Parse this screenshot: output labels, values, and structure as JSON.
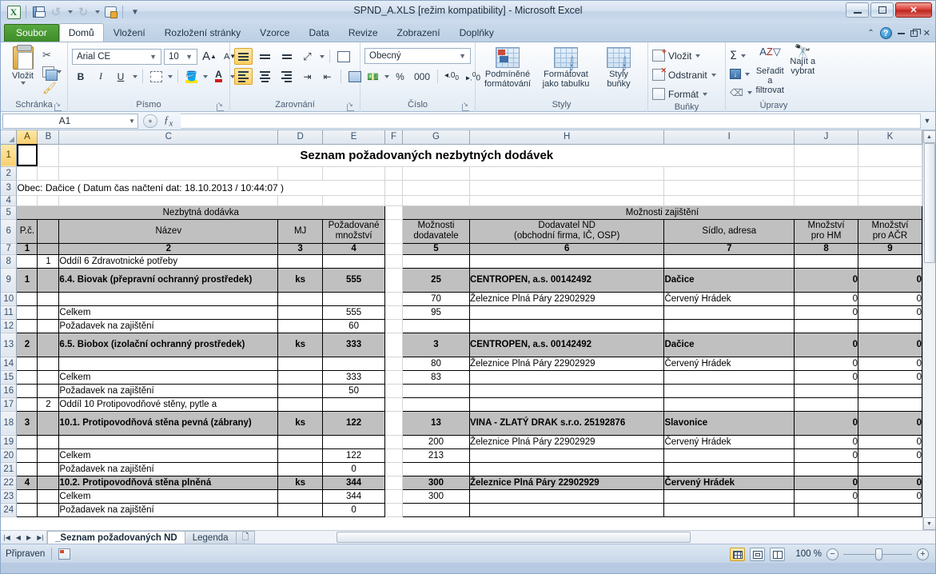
{
  "window": {
    "title": "SPND_A.XLS  [režim kompatibility]  -  Microsoft Excel",
    "qat": {
      "excel_logo": "X",
      "save_tooltip": "Uložit",
      "undo_tooltip": "Zpět",
      "redo_tooltip": "Znovu",
      "print_tooltip": "Náhled a tisk",
      "more_tooltip": "Přizpůsobit panel nástrojů Rychlý přístup"
    },
    "controls": {
      "minimize": "—",
      "maximize": "□",
      "close": "✕"
    }
  },
  "ribbon": {
    "tabs": [
      {
        "label": "Soubor",
        "kind": "file"
      },
      {
        "label": "Domů",
        "kind": "active"
      },
      {
        "label": "Vložení",
        "kind": "normal"
      },
      {
        "label": "Rozložení stránky",
        "kind": "normal"
      },
      {
        "label": "Vzorce",
        "kind": "normal"
      },
      {
        "label": "Data",
        "kind": "normal"
      },
      {
        "label": "Revize",
        "kind": "normal"
      },
      {
        "label": "Zobrazení",
        "kind": "normal"
      },
      {
        "label": "Doplňky",
        "kind": "normal"
      }
    ],
    "help_label": "?",
    "groups": {
      "clipboard": {
        "label": "Schránka",
        "paste": "Vložit",
        "cut": "Vyjmout",
        "copy": "Kopírovat",
        "format_painter": "Kopírovat formát"
      },
      "font": {
        "label": "Písmo",
        "font_name": "Arial CE",
        "font_size": "10",
        "grow": "A",
        "shrink": "A",
        "bold": "B",
        "italic": "I",
        "underline": "U",
        "borders": "Ohraničení",
        "fill_color": "Barva výplně",
        "font_color": "A"
      },
      "alignment": {
        "label": "Zarovnání",
        "align_top": "Zarovnat nahoru",
        "align_middle": "Zarovnat na střed svisle",
        "align_bottom": "Zarovnat dolů",
        "orientation": "Orientace",
        "align_left": "Zarovnat vlevo",
        "align_center": "Zarovnat na střed",
        "align_right": "Zarovnat vpravo",
        "decrease_indent": "Zmenšit odsazení",
        "increase_indent": "Zvětšit odsazení",
        "wrap_text": "Zalamovat text",
        "merge_center": "Sloučit a zarovnat na střed"
      },
      "number": {
        "label": "Číslo",
        "format": "Obecný",
        "accounting": "Formát účetnického čísla",
        "percent": "%",
        "comma": "000",
        "increase_decimal": "Přidat desetinné místo",
        "decrease_decimal": "Odebrat desetinné místo"
      },
      "styles": {
        "label": "Styly",
        "conditional": "Podmíněné formátování",
        "as_table": "Formátovat jako tabulku",
        "cell_styles": "Styly buňky"
      },
      "cells": {
        "label": "Buňky",
        "insert": "Vložit",
        "delete": "Odstranit",
        "format": "Formát"
      },
      "editing": {
        "label": "Úpravy",
        "autosum": "Σ",
        "fill": "Výplň",
        "clear": "Vymazat",
        "sort_filter": "Seřadit a filtrovat",
        "find_select": "Najít a vybrat"
      }
    }
  },
  "formula_bar": {
    "name_box": "A1",
    "formula": ""
  },
  "grid": {
    "column_headers": [
      "A",
      "B",
      "C",
      "D",
      "E",
      "F",
      "G",
      "H",
      "I",
      "J",
      "K"
    ],
    "selected_column": "A",
    "selected_row": "1",
    "row_numbers": [
      "1",
      "2",
      "3",
      "4",
      "5",
      "6",
      "7",
      "8",
      "9",
      "10",
      "11",
      "12",
      "13",
      "14",
      "15",
      "16",
      "17",
      "18",
      "19",
      "20",
      "21",
      "22",
      "23",
      "24"
    ],
    "doc_title": "Seznam požadovaných nezbytných dodávek",
    "info_line": "Obec: Dačice            ( Datum čas načtení dat: 18.10.2013 / 10:44:07 )",
    "group_headers": {
      "left": "Nezbytná dodávka",
      "right": "Možnosti zajištění"
    },
    "column_titles": {
      "pc": "P.č.",
      "nazev": "Název",
      "mj": "MJ",
      "pozadovane_mnozstvi": "Požadované množství",
      "moznosti_dodavatele": "Možnosti dodavatele",
      "dodavatel_nd": "Dodavatel ND (obchodní firma, IČ, OSP)",
      "dodavatel_nd_l1": "Dodavatel ND",
      "dodavatel_nd_l2": "(obchodní firma, IČ, OSP)",
      "sidlo": "Sídlo, adresa",
      "mnozstvi_hm_l1": "Množství",
      "mnozstvi_hm_l2": "pro HM",
      "mnozstvi_acr_l1": "Množství",
      "mnozstvi_acr_l2": "pro AČR"
    },
    "column_numbers": [
      "1",
      "2",
      "3",
      "4",
      "5",
      "6",
      "7",
      "8",
      "9"
    ],
    "rows": [
      {
        "row": "8",
        "style": "plain",
        "pc": "",
        "sub": "1",
        "nazev": "Oddíl 6 Zdravotnické potřeby",
        "mj": "",
        "qty": "",
        "supcount": "",
        "supplier": "",
        "address": "",
        "hm": "",
        "acr": ""
      },
      {
        "row": "9",
        "style": "shaded-bold",
        "tall": true,
        "pc": "1",
        "sub": "",
        "nazev": "6.4. Biovak (přepravní ochranný prostředek)",
        "mj": "ks",
        "qty": "555",
        "supcount": "25",
        "supplier": "CENTROPEN,  a.s. 00142492",
        "address": "Dačice",
        "hm": "0",
        "acr": "0"
      },
      {
        "row": "10",
        "style": "plain",
        "pc": "",
        "sub": "",
        "nazev": "",
        "mj": "",
        "qty": "",
        "supcount": "70",
        "supplier": "Železnice Plná Páry 22902929",
        "address": "Červený Hrádek",
        "hm": "0",
        "acr": "0"
      },
      {
        "row": "11",
        "style": "plain",
        "pc": "",
        "sub": "",
        "nazev": "Celkem",
        "mj": "",
        "qty": "555",
        "supcount": "95",
        "supplier": "",
        "address": "",
        "hm": "0",
        "acr": "0"
      },
      {
        "row": "12",
        "style": "plain",
        "pc": "",
        "sub": "",
        "nazev": "Požadavek na zajištění",
        "mj": "",
        "qty": "60",
        "supcount": "",
        "supplier": "",
        "address": "",
        "hm": "",
        "acr": ""
      },
      {
        "row": "13",
        "style": "shaded-bold",
        "tall": true,
        "pc": "2",
        "sub": "",
        "nazev": "6.5. Biobox (izolační ochranný prostředek)",
        "mj": "ks",
        "qty": "333",
        "supcount": "3",
        "supplier": "CENTROPEN,  a.s. 00142492",
        "address": "Dačice",
        "hm": "0",
        "acr": "0"
      },
      {
        "row": "14",
        "style": "plain",
        "pc": "",
        "sub": "",
        "nazev": "",
        "mj": "",
        "qty": "",
        "supcount": "80",
        "supplier": "Železnice Plná Páry 22902929",
        "address": "Červený Hrádek",
        "hm": "0",
        "acr": "0"
      },
      {
        "row": "15",
        "style": "plain",
        "pc": "",
        "sub": "",
        "nazev": "Celkem",
        "mj": "",
        "qty": "333",
        "supcount": "83",
        "supplier": "",
        "address": "",
        "hm": "0",
        "acr": "0"
      },
      {
        "row": "16",
        "style": "plain",
        "pc": "",
        "sub": "",
        "nazev": "Požadavek na zajištění",
        "mj": "",
        "qty": "50",
        "supcount": "",
        "supplier": "",
        "address": "",
        "hm": "",
        "acr": ""
      },
      {
        "row": "17",
        "style": "plain",
        "pc": "",
        "sub": "2",
        "nazev": "Oddíl 10 Protipovodňové stěny, pytle a",
        "mj": "",
        "qty": "",
        "supcount": "",
        "supplier": "",
        "address": "",
        "hm": "",
        "acr": ""
      },
      {
        "row": "18",
        "style": "shaded-bold",
        "tall": true,
        "pc": "3",
        "sub": "",
        "nazev": "10.1. Protipovodňová stěna pevná (zábrany)",
        "mj": "ks",
        "qty": "122",
        "supcount": "13",
        "supplier": "VINA - ZLATÝ DRAK s.r.o. 25192876",
        "address": "Slavonice",
        "hm": "0",
        "acr": "0"
      },
      {
        "row": "19",
        "style": "plain",
        "pc": "",
        "sub": "",
        "nazev": "",
        "mj": "",
        "qty": "",
        "supcount": "200",
        "supplier": "Železnice Plná Páry 22902929",
        "address": "Červený Hrádek",
        "hm": "0",
        "acr": "0"
      },
      {
        "row": "20",
        "style": "plain",
        "pc": "",
        "sub": "",
        "nazev": "Celkem",
        "mj": "",
        "qty": "122",
        "supcount": "213",
        "supplier": "",
        "address": "",
        "hm": "0",
        "acr": "0"
      },
      {
        "row": "21",
        "style": "plain",
        "pc": "",
        "sub": "",
        "nazev": "Požadavek na zajištění",
        "mj": "",
        "qty": "0",
        "supcount": "",
        "supplier": "",
        "address": "",
        "hm": "",
        "acr": ""
      },
      {
        "row": "22",
        "style": "shaded-bold",
        "pc": "4",
        "sub": "",
        "nazev": "10.2. Protipovodňová stěna plněná",
        "mj": "ks",
        "qty": "344",
        "supcount": "300",
        "supplier": "Železnice Plná Páry 22902929",
        "address": "Červený Hrádek",
        "hm": "0",
        "acr": "0"
      },
      {
        "row": "23",
        "style": "plain",
        "pc": "",
        "sub": "",
        "nazev": "Celkem",
        "mj": "",
        "qty": "344",
        "supcount": "300",
        "supplier": "",
        "address": "",
        "hm": "0",
        "acr": "0"
      },
      {
        "row": "24",
        "style": "plain",
        "pc": "",
        "sub": "",
        "nazev": "Požadavek na zajištění",
        "mj": "",
        "qty": "0",
        "supcount": "",
        "supplier": "",
        "address": "",
        "hm": "",
        "acr": ""
      }
    ]
  },
  "sheet_tabs": {
    "nav": [
      "|◀",
      "◀",
      "▶",
      "▶|"
    ],
    "tabs": [
      {
        "label": "_Seznam požadovaných ND",
        "active": true
      },
      {
        "label": "Legenda",
        "active": false
      }
    ],
    "insert_sheet": "Vložit list"
  },
  "status_bar": {
    "state": "Připraven",
    "view_normal": "Normálně",
    "view_layout": "Rozložení stránky",
    "view_pagebreak": "Náhled zalomení stránek",
    "zoom": "100 %"
  },
  "colors": {
    "accent_green": "#217346",
    "shade": "#c0c0c0",
    "selection": "#ffd062",
    "close_red": "#bc2720"
  }
}
